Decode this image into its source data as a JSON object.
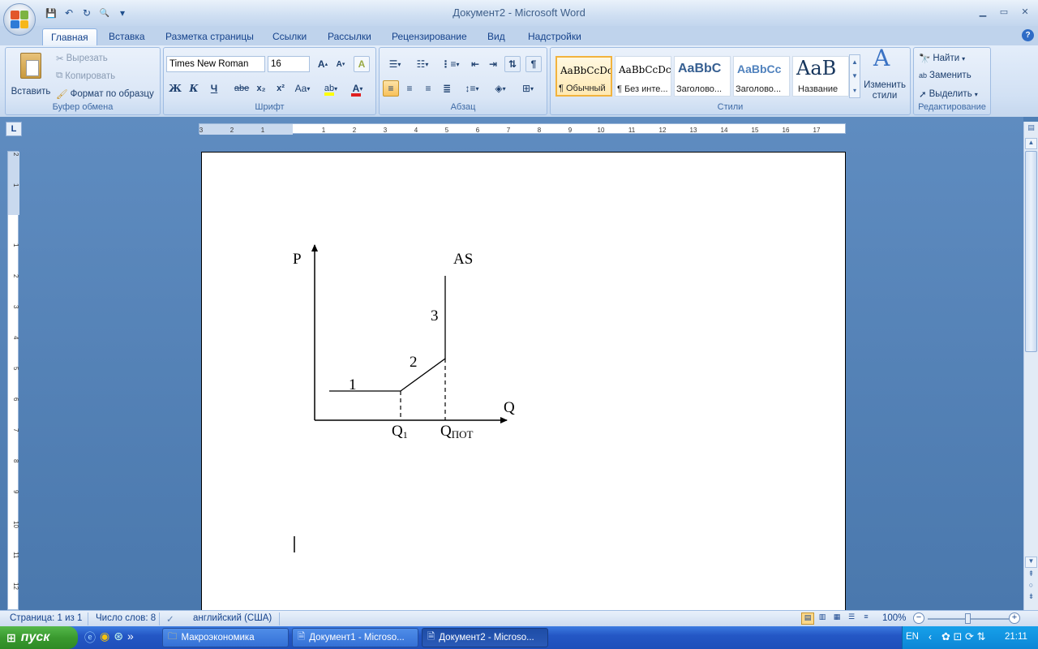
{
  "window": {
    "title": "Документ2 - Microsoft Word",
    "controls": {
      "minimize": "▁",
      "maximize": "▭",
      "close": "✕"
    },
    "doc_controls": {
      "minimize": "▁",
      "maximize": "▭",
      "close": "✕"
    }
  },
  "qat": {
    "save": "💾",
    "undo": "↶",
    "redo": "↻",
    "print_preview": "🔍",
    "customize": "▾"
  },
  "tabs": [
    "Главная",
    "Вставка",
    "Разметка страницы",
    "Ссылки",
    "Рассылки",
    "Рецензирование",
    "Вид",
    "Надстройки"
  ],
  "help_icon": "?",
  "clipboard": {
    "label": "Буфер обмена",
    "paste": "Вставить",
    "cut": "Вырезать",
    "copy": "Копировать",
    "format_painter": "Формат по образцу"
  },
  "font": {
    "label": "Шрифт",
    "family": "Times New Roman",
    "size": "16",
    "grow": "A",
    "shrink": "A",
    "clear": "A",
    "bold": "Ж",
    "italic": "К",
    "underline": "Ч",
    "strike": "abe",
    "subscript": "x₂",
    "superscript": "x²",
    "case": "Aa",
    "highlight": "ab",
    "color": "A",
    "highlight_color": "#ffff00",
    "font_color": "#e02020"
  },
  "paragraph": {
    "label": "Абзац",
    "show_marks": "¶"
  },
  "styles": {
    "label": "Стили",
    "items": [
      {
        "sample": "AaBbCcDc",
        "name": "¶ Обычный"
      },
      {
        "sample": "AaBbCcDc",
        "name": "¶ Без инте..."
      },
      {
        "sample": "AaBbC",
        "name": "Заголово..."
      },
      {
        "sample": "AaBbCc",
        "name": "Заголово..."
      },
      {
        "sample": "AaB",
        "name": "Название"
      }
    ],
    "change": "Изменить\nстили"
  },
  "editing": {
    "label": "Редактирование",
    "find": "Найти",
    "replace": "Заменить",
    "select": "Выделить"
  },
  "ruler": {
    "corner": "L",
    "h_ticks": [
      "3",
      "2",
      "1",
      "1",
      "2",
      "3",
      "4",
      "5",
      "6",
      "7",
      "8",
      "9",
      "10",
      "11",
      "12",
      "13",
      "14",
      "15",
      "16",
      "17"
    ],
    "v_ticks": [
      "2",
      "1",
      "1",
      "2",
      "3",
      "4",
      "5",
      "6",
      "7",
      "8",
      "9",
      "10",
      "11",
      "12"
    ]
  },
  "diagram": {
    "p_label": "P",
    "q_label": "Q",
    "as_label": "AS",
    "seg1": "1",
    "seg2": "2",
    "seg3": "3",
    "q1_main": "Q",
    "q1_sub": "1",
    "qpot_main": "Q",
    "qpot_sub": "ПОТ"
  },
  "status": {
    "page": "Страница: 1 из 1",
    "words": "Число слов: 8",
    "language": "английский (США)",
    "zoom": "100%"
  },
  "taskbar": {
    "start": "пуск",
    "quick_more": "»",
    "windows": [
      "Макроэкономика",
      "Документ1 - Microso...",
      "Документ2 - Microso..."
    ],
    "lang": "EN",
    "time": "21:11"
  }
}
